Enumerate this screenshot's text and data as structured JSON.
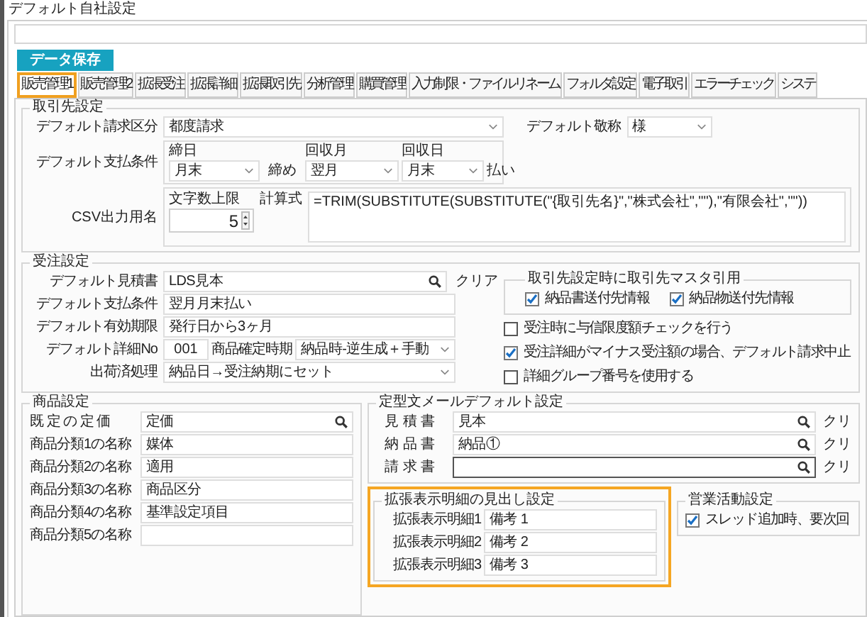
{
  "window": {
    "title": "デフォルト自社設定"
  },
  "save_button": "データ保存",
  "tabs": [
    {
      "label": "販売管理1",
      "selected": true
    },
    {
      "label": "販売管理2",
      "selected": false
    },
    {
      "label": "拡張受注",
      "selected": false
    },
    {
      "label": "拡張詳細",
      "selected": false
    },
    {
      "label": "拡張取引先",
      "selected": false
    },
    {
      "label": "分析管理",
      "selected": false
    },
    {
      "label": "購買管理",
      "selected": false
    },
    {
      "label": "入力制限・ファイルリネーム",
      "selected": false
    },
    {
      "label": "フォルダ設定",
      "selected": false
    },
    {
      "label": "電子取引",
      "selected": false
    },
    {
      "label": "エラーチェック",
      "selected": false
    },
    {
      "label": "システ",
      "selected": false
    }
  ],
  "customer_settings": {
    "title": "取引先設定",
    "billing_type": {
      "label": "デフォルト請求区分",
      "value": "都度請求"
    },
    "honorific": {
      "label": "デフォルト敬称",
      "value": "様"
    },
    "payment_terms": {
      "label": "デフォルト支払条件",
      "closing_day": {
        "label": "締日",
        "value": "月末"
      },
      "closing_text": "締め",
      "collection_month": {
        "label": "回収月",
        "value": "翌月"
      },
      "collection_day": {
        "label": "回収日",
        "value": "月末"
      },
      "pay_text": "払い"
    },
    "csv_name": {
      "label": "CSV出力用名",
      "max_chars": {
        "label": "文字数上限",
        "value": "5"
      },
      "formula": {
        "label": "計算式",
        "value": "=TRIM(SUBSTITUTE(SUBSTITUTE(\"{取引先名}\",\"株式会社\",\"\"),\"有限会社\",\"\"))"
      }
    }
  },
  "order_settings": {
    "title": "受注設定",
    "fields": [
      {
        "kind": "lookup",
        "label": "デフォルト見積書",
        "value": "LDS見本",
        "clear": "クリア"
      },
      {
        "kind": "text",
        "label": "デフォルト支払条件",
        "value": "翌月月末払い"
      },
      {
        "kind": "text",
        "label": "デフォルト有効期限",
        "value": "発行日から3ヶ月"
      },
      {
        "kind": "detail",
        "label": "デフォルト詳細No",
        "value": "001",
        "sub_label": "商品確定時期",
        "sub_value": "納品時-逆生成＋手動"
      },
      {
        "kind": "select",
        "label": "出荷済処理",
        "value": "納品日→受注納期にセット"
      }
    ],
    "master_group": {
      "title": "取引先設定時に取引先マスタ引用",
      "checks": [
        {
          "label": "納品書送付先情報",
          "checked": true
        },
        {
          "label": "納品物送付先情報",
          "checked": true
        }
      ]
    },
    "options": [
      {
        "label": "受注時に与信限度額チェックを行う",
        "checked": false
      },
      {
        "label": "受注詳細がマイナス受注額の場合、デフォルト請求中止",
        "checked": true
      },
      {
        "label": "詳細グループ番号を使用する",
        "checked": false
      }
    ]
  },
  "product_settings": {
    "title": "商品設定",
    "fields": [
      {
        "kind": "lookup",
        "label": "既 定 の 定 価",
        "value": "定価"
      },
      {
        "kind": "text",
        "label": "商品分類1の名称",
        "value": "媒体"
      },
      {
        "kind": "text",
        "label": "商品分類2の名称",
        "value": "適用"
      },
      {
        "kind": "text",
        "label": "商品分類3の名称",
        "value": "商品区分"
      },
      {
        "kind": "text",
        "label": "商品分類4の名称",
        "value": "基準設定項目"
      },
      {
        "kind": "text",
        "label": "商品分類5の名称"
      }
    ]
  },
  "mail_settings": {
    "title": "定型文メールデフォルト設定",
    "rows": [
      {
        "label": "見 積 書",
        "value": "見本",
        "clear": "クリ",
        "focused": false
      },
      {
        "label": "納 品 書",
        "value": "納品①",
        "clear": "クリ",
        "focused": false
      },
      {
        "label": "請 求 書",
        "clear": "クリ",
        "focused": true
      }
    ]
  },
  "extended_headings": {
    "title": "拡張表示明細の見出し設定",
    "highlighted": true,
    "rows": [
      {
        "label": "拡張表示明細1",
        "value": "備考 1"
      },
      {
        "label": "拡張表示明細2",
        "value": "備考 2"
      },
      {
        "label": "拡張表示明細3",
        "value": "備考 3"
      }
    ]
  },
  "sales_activity": {
    "title": "営業活動設定",
    "checks": [
      {
        "label": "スレッド追加時、要次回",
        "checked": true
      }
    ]
  }
}
